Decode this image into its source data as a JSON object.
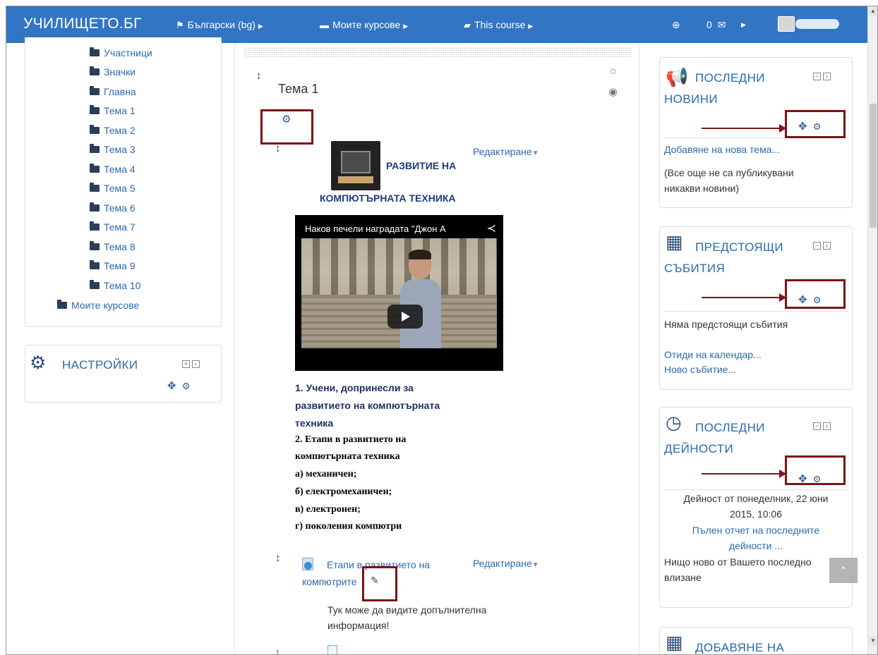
{
  "navbar": {
    "brand": "УЧИЛИЩЕТО.БГ",
    "language": "Български (bg)",
    "my_courses": "Моите курсове",
    "this_course": "This course",
    "messages_count": "0"
  },
  "nav_tree": {
    "items": [
      "Участници",
      "Значки",
      "Главна",
      "Тема 1",
      "Тема 2",
      "Тема 3",
      "Тема 4",
      "Тема 5",
      "Тема 6",
      "Тема 7",
      "Тема 8",
      "Тема 9",
      "Тема 10"
    ],
    "my_courses": "Моите курсове"
  },
  "settings_block": {
    "title": "НАСТРОЙКИ"
  },
  "main": {
    "topic_title": "Тема 1",
    "edit_label": "Редактиране",
    "resource_title_line1": "РАЗВИТИЕ НА",
    "resource_title_line2": "КОМПЮТЪРНАТА ТЕХНИКА",
    "video_title": "Наков печели наградата \"Джон А",
    "description": {
      "line1": "1. Учени, допринесли за",
      "line2": "развитието на компютърната",
      "line3": "техника",
      "line4": "2. Етапи в развитието на",
      "line5": "компютърната техника",
      "line6": "а) механичен;",
      "line7": "б) електромеханичен;",
      "line8": "в) електронен;",
      "line9": "г) поколения компютри"
    },
    "link_line1": "Етапи в развитието на",
    "link_line2": "компютрите",
    "info_line1": "Тук може да видите допълнителна",
    "info_line2": "информация!"
  },
  "news_block": {
    "title_line1": "ПОСЛЕДНИ",
    "title_line2": "НОВИНИ",
    "add_topic": "Добавяне на нова тема...",
    "empty_line1": "(Все още не са публикувани",
    "empty_line2": "никакви новини)"
  },
  "events_block": {
    "title_line1": "ПРЕДСТОЯЩИ",
    "title_line2": "СЪБИТИЯ",
    "none": "Няма предстоящи събития",
    "goto_calendar": "Отиди на календар...",
    "new_event": "Ново събитие..."
  },
  "activity_block": {
    "title_line1": "ПОСЛЕДНИ",
    "title_line2": "ДЕЙНОСТИ",
    "since_line1": "Дейност от понеделник, 22 юни",
    "since_line2": "2015, 10:06",
    "full_report_line1": "Пълен отчет на последните",
    "full_report_line2": "дейности ...",
    "nothing_line1": "Нищо ново от Вашето последно",
    "nothing_line2": "влизане"
  },
  "add_block": {
    "title": "ДОБАВЯНЕ НА"
  },
  "colors": {
    "navbar": "#3275c4",
    "link": "#2a6ab0",
    "annotation": "#7b1416"
  }
}
